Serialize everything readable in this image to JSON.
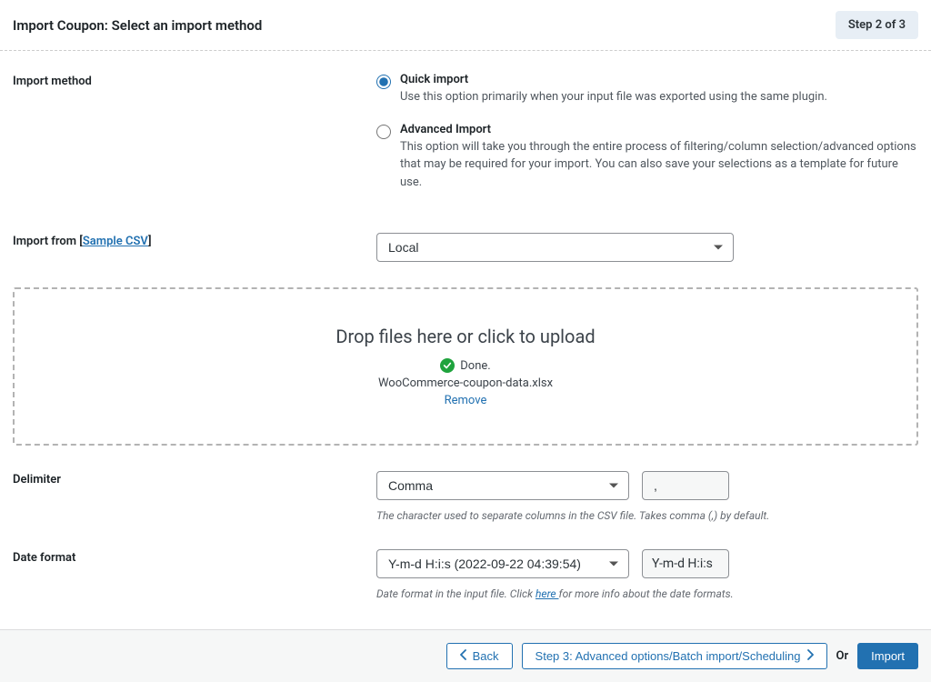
{
  "header": {
    "title": "Import Coupon: Select an import method",
    "step_label": "Step 2 of 3"
  },
  "import_method": {
    "label": "Import method",
    "quick": {
      "title": "Quick import",
      "desc": "Use this option primarily when your input file was exported using the same plugin."
    },
    "advanced": {
      "title": "Advanced Import",
      "desc": "This option will take you through the entire process of filtering/column selection/advanced options that may be required for your import. You can also save your selections as a template for future use."
    }
  },
  "import_from": {
    "label_prefix": "Import from [",
    "sample_link": "Sample CSV",
    "label_suffix": "]",
    "value": "Local"
  },
  "dropzone": {
    "title": "Drop files here or click to upload",
    "done": "Done.",
    "filename": "WooCommerce-coupon-data.xlsx",
    "remove": "Remove"
  },
  "delimiter": {
    "label": "Delimiter",
    "value": "Comma",
    "char": ",",
    "help": "The character used to separate columns in the CSV file. Takes comma (,) by default."
  },
  "date_format": {
    "label": "Date format",
    "value": "Y-m-d H:i:s (2022-09-22 04:39:54)",
    "display": "Y-m-d H:i:s",
    "help_prefix": "Date format in the input file. Click ",
    "help_link": "here ",
    "help_suffix": "for more info about the date formats."
  },
  "footer": {
    "back": "Back",
    "next": "Step 3: Advanced options/Batch import/Scheduling",
    "or": "Or",
    "import": "Import"
  }
}
